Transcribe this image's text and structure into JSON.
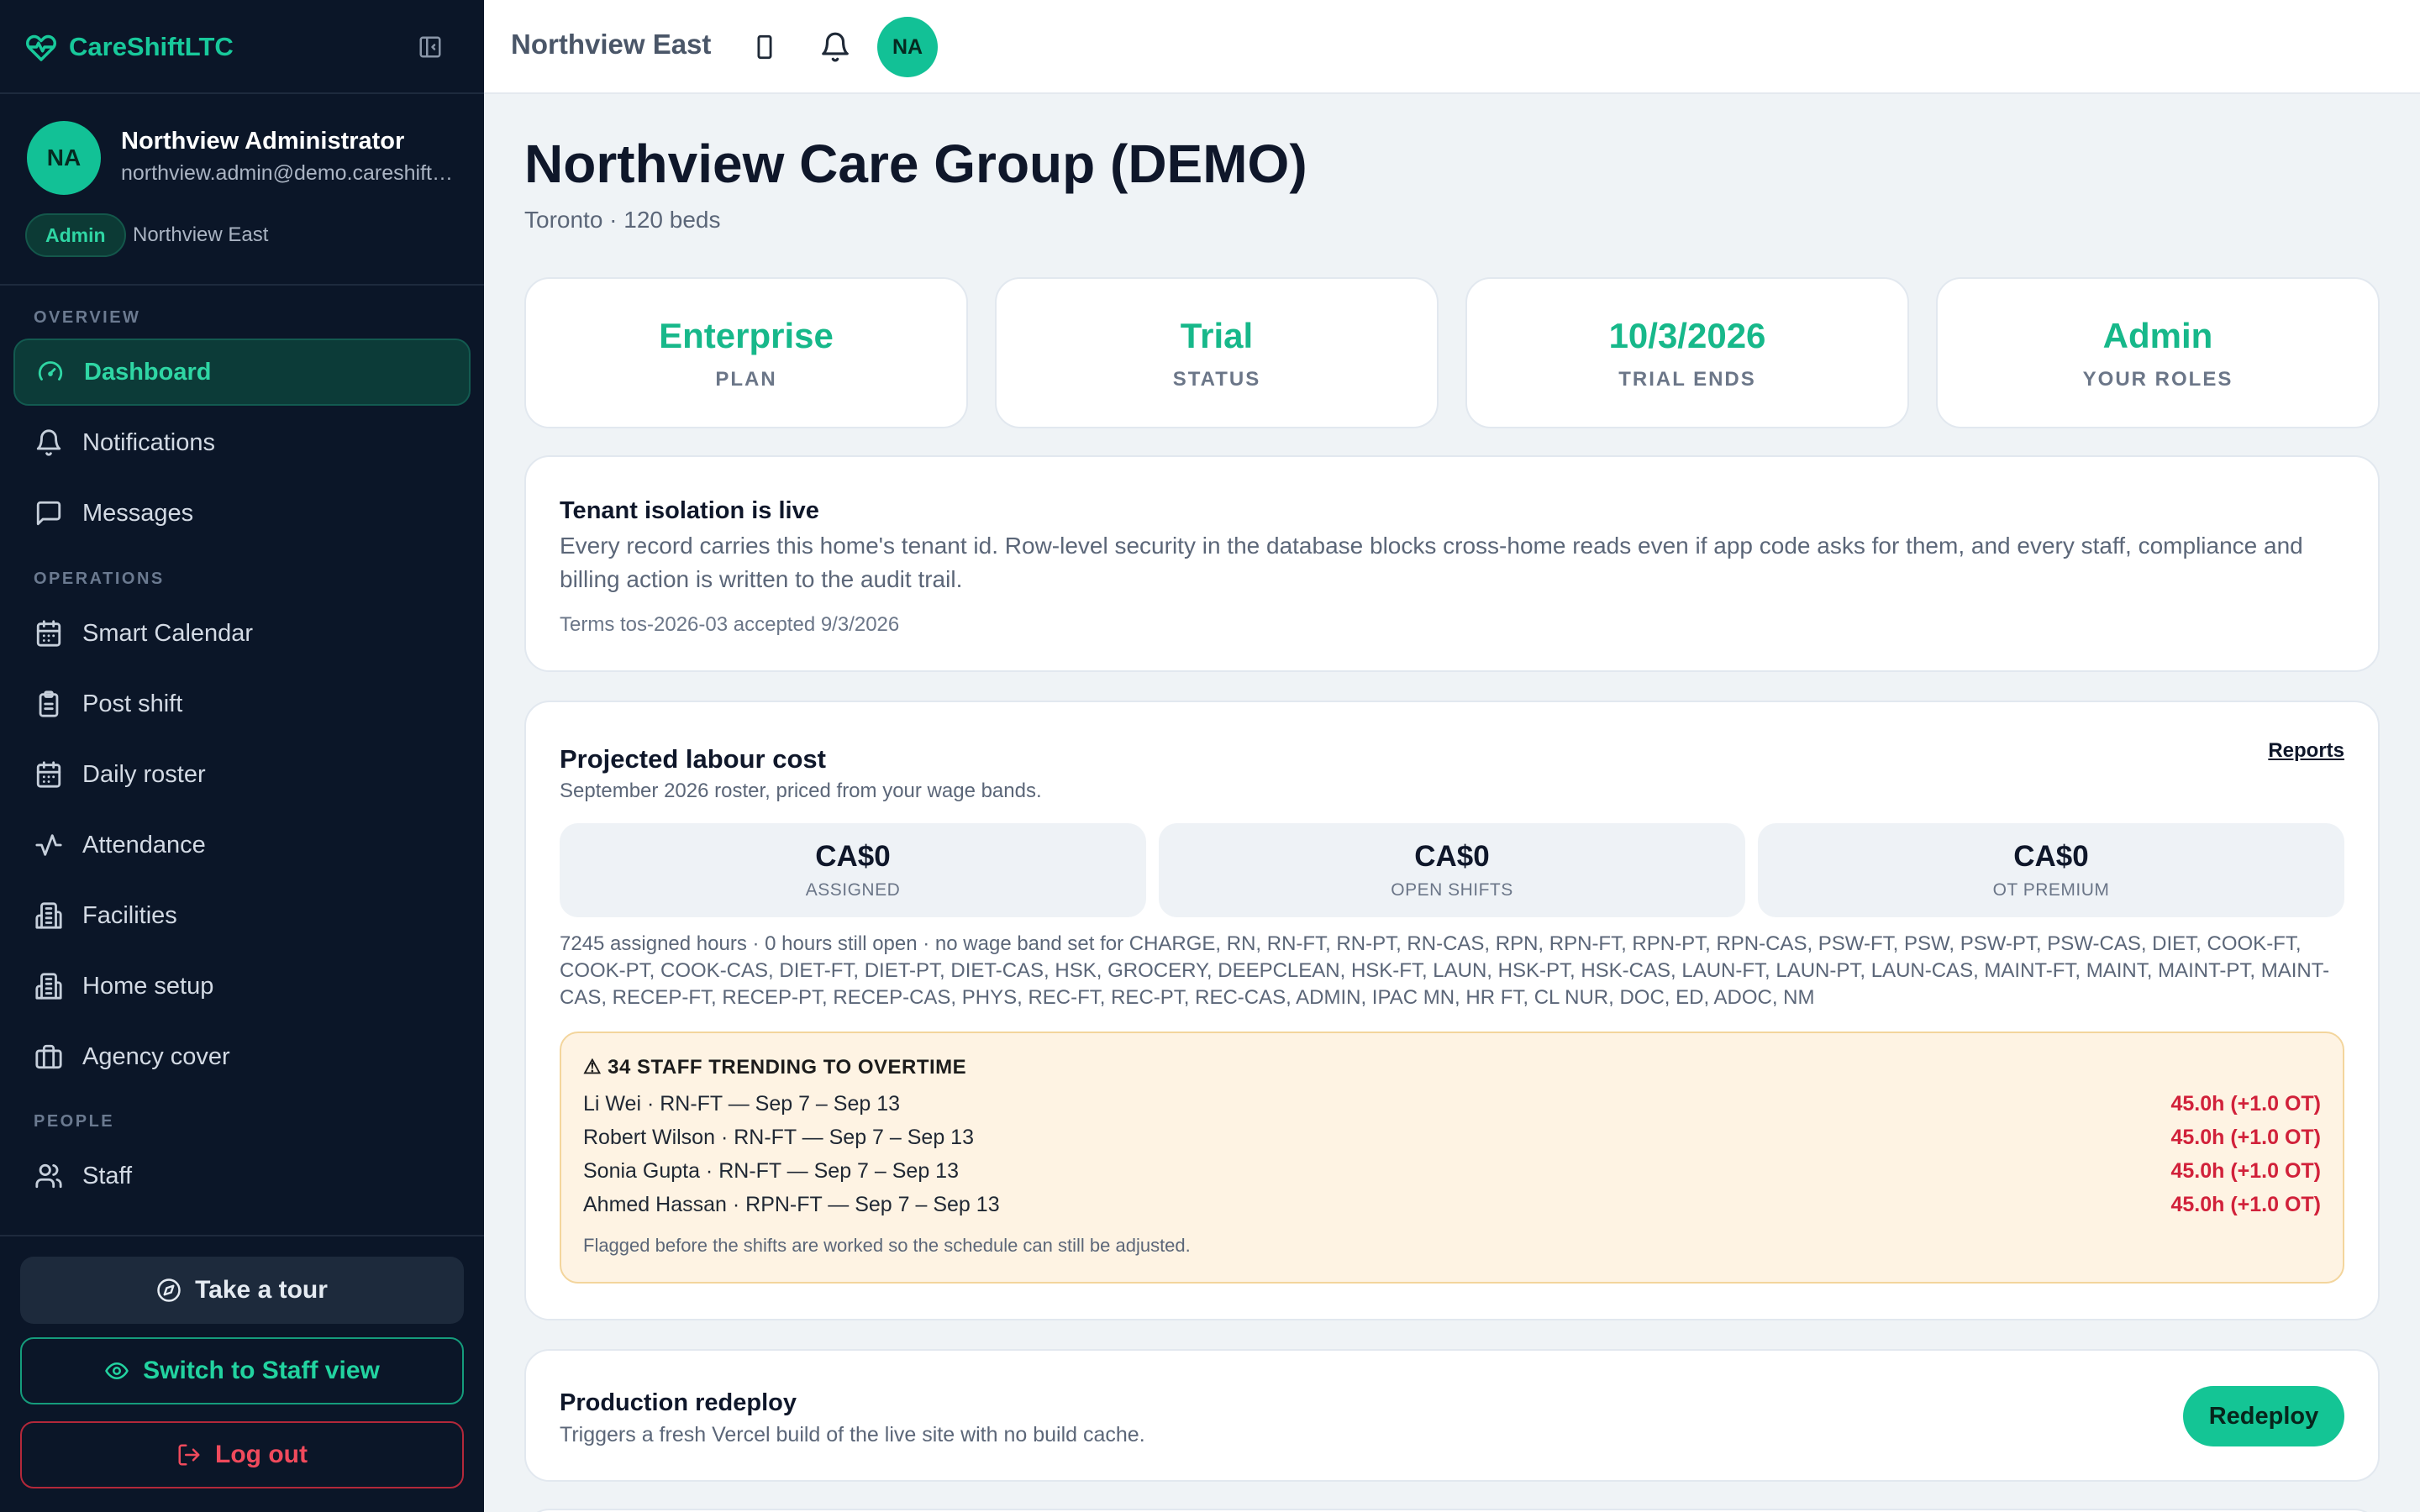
{
  "app": {
    "name": "CareShiftLTC"
  },
  "user": {
    "initials": "NA",
    "name": "Northview Administrator",
    "email": "northview.admin@demo.careshift.ltc",
    "role": "Admin",
    "facility": "Northview East"
  },
  "nav": {
    "sections": {
      "overview": "OVERVIEW",
      "operations": "OPERATIONS",
      "people": "PEOPLE"
    },
    "items": [
      {
        "label": "Dashboard",
        "icon": "gauge-icon",
        "active": true
      },
      {
        "label": "Notifications",
        "icon": "bell-icon"
      },
      {
        "label": "Messages",
        "icon": "message-icon"
      },
      {
        "label": "Smart Calendar",
        "icon": "calendar-icon"
      },
      {
        "label": "Post shift",
        "icon": "clipboard-icon"
      },
      {
        "label": "Daily roster",
        "icon": "calendar-icon"
      },
      {
        "label": "Attendance",
        "icon": "activity-icon"
      },
      {
        "label": "Facilities",
        "icon": "building-icon"
      },
      {
        "label": "Home setup",
        "icon": "building-icon"
      },
      {
        "label": "Agency cover",
        "icon": "briefcase-icon"
      },
      {
        "label": "Staff",
        "icon": "users-icon"
      }
    ]
  },
  "sidebar_actions": {
    "tour": "Take a tour",
    "switch": "Switch to Staff view",
    "logout": "Log out"
  },
  "topbar": {
    "facility": "Northview East",
    "avatar": "NA"
  },
  "page": {
    "title": "Northview Care Group (DEMO)",
    "subtitle": "Toronto · 120 beds"
  },
  "stats": [
    {
      "value": "Enterprise",
      "label": "PLAN"
    },
    {
      "value": "Trial",
      "label": "STATUS"
    },
    {
      "value": "10/3/2026",
      "label": "TRIAL ENDS"
    },
    {
      "value": "Admin",
      "label": "YOUR ROLES"
    }
  ],
  "isolation": {
    "title": "Tenant isolation is live",
    "body": "Every record carries this home's tenant id. Row-level security in the database blocks cross-home reads even if app code asks for them, and every staff, compliance and billing action is written to the audit trail.",
    "terms": "Terms tos-2026-03 accepted 9/3/2026"
  },
  "labour": {
    "title": "Projected labour cost",
    "subtitle": "September 2026 roster, priced from your wage bands.",
    "link": "Reports",
    "tiles": [
      {
        "value": "CA$0",
        "label": "ASSIGNED"
      },
      {
        "value": "CA$0",
        "label": "OPEN SHIFTS"
      },
      {
        "value": "CA$0",
        "label": "OT PREMIUM"
      }
    ],
    "note": "7245 assigned hours · 0 hours still open · no wage band set for CHARGE, RN, RN-FT, RN-PT, RN-CAS, RPN, RPN-FT, RPN-PT, RPN-CAS, PSW-FT, PSW, PSW-PT, PSW-CAS, DIET, COOK-FT, COOK-PT, COOK-CAS, DIET-FT, DIET-PT, DIET-CAS, HSK, GROCERY, DEEPCLEAN, HSK-FT, LAUN, HSK-PT, HSK-CAS, LAUN-FT, LAUN-PT, LAUN-CAS, MAINT-FT, MAINT, MAINT-PT, MAINT-CAS, RECEP-FT, RECEP-PT, RECEP-CAS, PHYS, REC-FT, REC-PT, REC-CAS, ADMIN, IPAC MN, HR FT, CL NUR, DOC, ED, ADOC, NM",
    "overtime": {
      "heading": "⚠ 34 STAFF TRENDING TO OVERTIME",
      "rows": [
        {
          "who": "Li Wei · RN-FT — Sep 7 – Sep 13",
          "hours": "45.0h (+1.0 OT)"
        },
        {
          "who": "Robert Wilson · RN-FT — Sep 7 – Sep 13",
          "hours": "45.0h (+1.0 OT)"
        },
        {
          "who": "Sonia Gupta · RN-FT — Sep 7 – Sep 13",
          "hours": "45.0h (+1.0 OT)"
        },
        {
          "who": "Ahmed Hassan · RPN-FT — Sep 7 – Sep 13",
          "hours": "45.0h (+1.0 OT)"
        }
      ],
      "footer": "Flagged before the shifts are worked so the schedule can still be adjusted."
    }
  },
  "redeploy": {
    "title": "Production redeploy",
    "subtitle": "Triggers a fresh Vercel build of the live site with no build cache.",
    "button": "Redeploy"
  },
  "colors": {
    "accent": "#18c99b",
    "sidebar_bg": "#0b1628",
    "danger": "#d1213a",
    "warning_bg": "#fef3e3"
  }
}
